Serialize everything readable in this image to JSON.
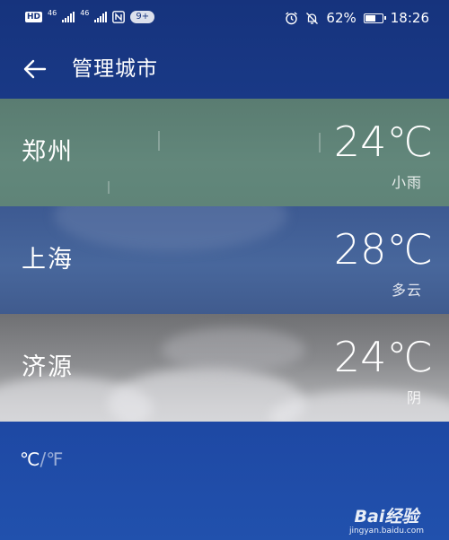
{
  "status_bar": {
    "hd_label": "HD",
    "net_1": "46",
    "net_2": "46",
    "nfc_icon": "nfc-icon",
    "notif_count": "9+",
    "alarm_icon": "alarm-clock-icon",
    "mute_icon": "bell-off-icon",
    "battery_percent": "62%",
    "battery_level": 0.62,
    "time": "18:26"
  },
  "header": {
    "back_icon": "arrow-left-icon",
    "title": "管理城市"
  },
  "cities": [
    {
      "name": "郑州",
      "temp": "24℃",
      "condition": "小雨",
      "bg_color": "#5f8478"
    },
    {
      "name": "上海",
      "temp": "28℃",
      "condition": "多云",
      "bg_color": "#45639a"
    },
    {
      "name": "济源",
      "temp": "24℃",
      "condition": "阴",
      "bg_color": "#8a8b8e"
    }
  ],
  "unit_toggle": {
    "celsius": "℃",
    "separator": "/",
    "fahrenheit": "℉"
  },
  "watermark": {
    "logo": "Bai经验",
    "sub": "jingyan.baidu.com"
  },
  "colors": {
    "background": "#1b3d8c",
    "text": "#ffffff"
  }
}
